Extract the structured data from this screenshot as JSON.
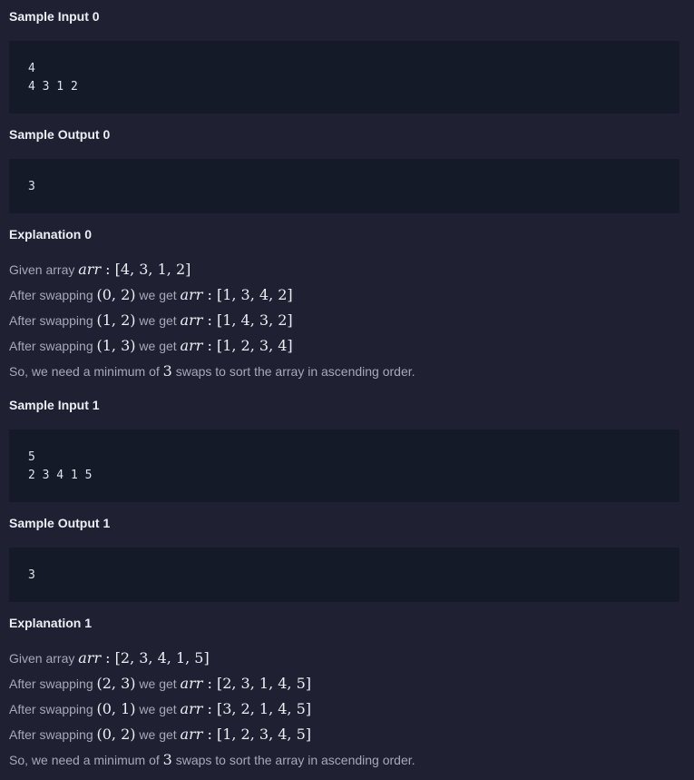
{
  "sections": [
    {
      "input_heading": "Sample Input 0",
      "input_lines": [
        "4",
        "4 3 1 2"
      ],
      "output_heading": "Sample Output 0",
      "output_lines": [
        "3"
      ],
      "explanation_heading": "Explanation 0",
      "given_prefix": "Given array ",
      "given_array": "[4, 3, 1, 2]",
      "swaps": [
        {
          "prefix": "After swapping ",
          "pair": "(0, 2)",
          "mid": " we get ",
          "result": "[1, 3, 4, 2]"
        },
        {
          "prefix": "After swapping ",
          "pair": "(1, 2)",
          "mid": " we get ",
          "result": "[1, 4, 3, 2]"
        },
        {
          "prefix": "After swapping ",
          "pair": "(1, 3)",
          "mid": " we get ",
          "result": "[1, 2, 3, 4]"
        }
      ],
      "summary_prefix": "So, we need a minimum of ",
      "summary_count": "3",
      "summary_suffix": " swaps to sort the array in ascending order."
    },
    {
      "input_heading": "Sample Input 1",
      "input_lines": [
        "5",
        "2 3 4 1 5"
      ],
      "output_heading": "Sample Output 1",
      "output_lines": [
        "3"
      ],
      "explanation_heading": "Explanation 1",
      "given_prefix": "Given array ",
      "given_array": "[2, 3, 4, 1, 5]",
      "swaps": [
        {
          "prefix": "After swapping ",
          "pair": "(2, 3)",
          "mid": " we get ",
          "result": "[2, 3, 1, 4, 5]"
        },
        {
          "prefix": "After swapping ",
          "pair": "(0, 1)",
          "mid": " we get ",
          "result": "[3, 2, 1, 4, 5]"
        },
        {
          "prefix": "After swapping ",
          "pair": "(0, 2)",
          "mid": " we get ",
          "result": "[1, 2, 3, 4, 5]"
        }
      ],
      "summary_prefix": "So, we need a minimum of ",
      "summary_count": "3",
      "summary_suffix": " swaps to sort the array in ascending order."
    }
  ],
  "arr_var": "arr",
  "colon": " : "
}
